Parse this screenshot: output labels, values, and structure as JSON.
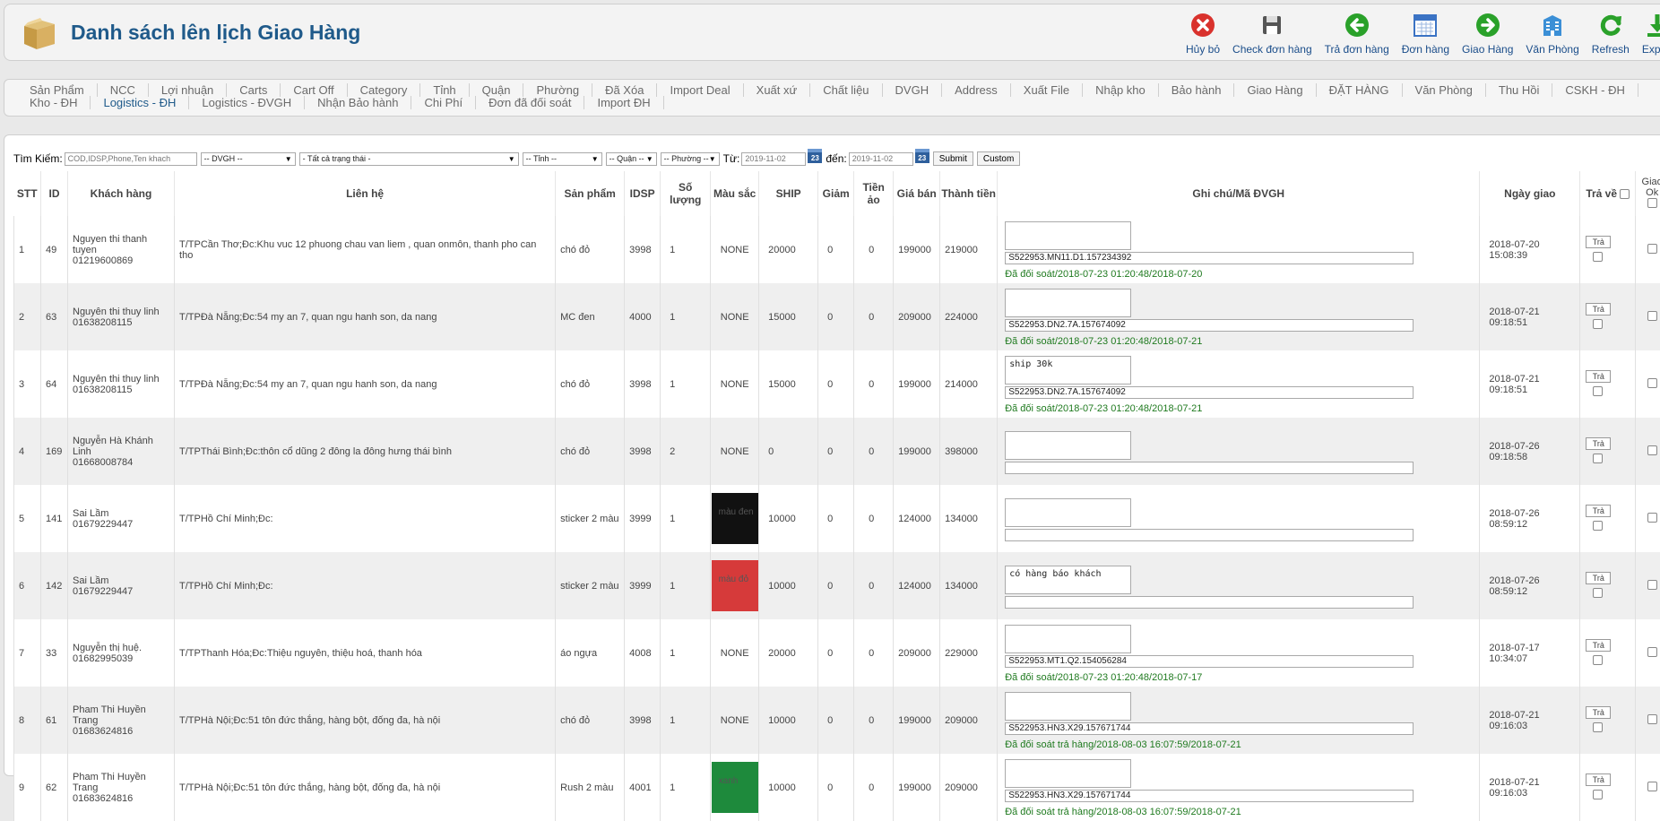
{
  "header": {
    "title": "Danh sách lên lịch Giao Hàng"
  },
  "toolbar": [
    {
      "label": "Hủy bỏ",
      "icon": "cancel-icon",
      "color": "#d9322d"
    },
    {
      "label": "Check đơn hàng",
      "icon": "save-icon",
      "color": "#555555"
    },
    {
      "label": "Trả đơn hàng",
      "icon": "back-arrow-icon",
      "color": "#2aa12a"
    },
    {
      "label": "Đơn hàng",
      "icon": "calendar-icon",
      "color": "#3b73c4"
    },
    {
      "label": "Giao Hàng",
      "icon": "forward-arrow-icon",
      "color": "#2aa12a"
    },
    {
      "label": "Văn Phòng",
      "icon": "building-icon",
      "color": "#3b8fd6"
    },
    {
      "label": "Refresh",
      "icon": "refresh-icon",
      "color": "#2aa12a"
    },
    {
      "label": "Export",
      "icon": "download-icon",
      "color": "#2aa12a"
    }
  ],
  "nav": {
    "row1": [
      "Sản Phẩm",
      "NCC",
      "Lợi nhuận",
      "Carts",
      "Cart Off",
      "Category",
      "Tỉnh",
      "Quận",
      "Phường",
      "Đã Xóa",
      "Import Deal",
      "Xuất xứ",
      "Chất liệu",
      "DVGH",
      "Address",
      "Xuất File",
      "Nhập kho",
      "Bảo hành",
      "Giao Hàng",
      "ĐẶT HÀNG",
      "Văn Phòng",
      "Thu Hồi",
      "CSKH - ĐH"
    ],
    "row2": [
      "Kho - ĐH",
      "Logistics - ĐH",
      "Logistics - ĐVGH",
      "Nhận Bảo hành",
      "Chi Phí",
      "Đơn đã đối soát",
      "Import ĐH"
    ]
  },
  "search": {
    "label": "Tìm Kiếm:",
    "placeholder": "COD,IDSP,Phone,Ten khach",
    "dvgh": "-- DVGH --",
    "status": "- Tất cả trạng thái -",
    "tinh": "-- Tỉnh --",
    "quan": "-- Quận --",
    "phuong": "-- Phường --",
    "from_label": "Từ:",
    "from": "2019-11-02",
    "to_label": "đến:",
    "to": "2019-11-02",
    "cal_label": "23",
    "submit": "Submit",
    "custom": "Custom"
  },
  "table": {
    "headers": {
      "stt": "STT",
      "id": "ID",
      "customer": "Khách hàng",
      "contact": "Liên hệ",
      "product": "Sản phẩm",
      "idsp": "IDSP",
      "qty": "Số lượng",
      "color": "Màu sắc",
      "ship": "SHIP",
      "discount": "Giảm",
      "virtual": "Tiền ảo",
      "price": "Giá bán",
      "total": "Thành tiền",
      "note": "Ghi chú/Mã ĐVGH",
      "date": "Ngày giao",
      "return": "Trả về",
      "ok": "Giao Ok"
    },
    "return_btn": "Trả",
    "rows": [
      {
        "stt": "1",
        "id": "49",
        "name": "Nguyen thi thanh tuyen",
        "phone": "01219600869",
        "contact": "T/TPCần Thơ;Đc:Khu vuc 12 phuong chau van liem , quan onmôn, thanh pho can tho",
        "product": "chó đỏ",
        "idsp": "3998",
        "qty": "1",
        "color": "NONE",
        "swatch": "",
        "ship": "20000",
        "discount": "0",
        "virtual": "0",
        "price": "199000",
        "total": "219000",
        "note": "",
        "code": "S522953.MN11.D1.157234392",
        "status": "Đã đối soát/2018-07-23 01:20:48/2018-07-20",
        "date": "2018-07-20",
        "time": "15:08:39"
      },
      {
        "stt": "2",
        "id": "63",
        "name": "Nguyên thi thuy linh",
        "phone": "01638208115",
        "contact": "T/TPĐà Nẵng;Đc:54 my an 7, quan ngu hanh son, da nang",
        "product": "MC đen",
        "idsp": "4000",
        "qty": "1",
        "color": "NONE",
        "swatch": "",
        "ship": "15000",
        "discount": "0",
        "virtual": "0",
        "price": "209000",
        "total": "224000",
        "note": "",
        "code": "S522953.DN2.7A.157674092",
        "status": "Đã đối soát/2018-07-23 01:20:48/2018-07-21",
        "date": "2018-07-21",
        "time": "09:18:51"
      },
      {
        "stt": "3",
        "id": "64",
        "name": "Nguyên thi thuy linh",
        "phone": "01638208115",
        "contact": "T/TPĐà Nẵng;Đc:54 my an 7, quan ngu hanh son, da nang",
        "product": "chó đỏ",
        "idsp": "3998",
        "qty": "1",
        "color": "NONE",
        "swatch": "",
        "ship": "15000",
        "discount": "0",
        "virtual": "0",
        "price": "199000",
        "total": "214000",
        "note": "ship 30k",
        "code": "S522953.DN2.7A.157674092",
        "status": "Đã đối soát/2018-07-23 01:20:48/2018-07-21",
        "date": "2018-07-21",
        "time": "09:18:51"
      },
      {
        "stt": "4",
        "id": "169",
        "name": "Nguyễn Hà Khánh Linh",
        "phone": "01668008784",
        "contact": "T/TPThái Bình;Đc:thôn cổ dũng 2 đông la đông hưng thái bình",
        "product": "chó đỏ",
        "idsp": "3998",
        "qty": "2",
        "color": "NONE",
        "swatch": "",
        "ship": "0",
        "discount": "0",
        "virtual": "0",
        "price": "199000",
        "total": "398000",
        "note": "",
        "code": "",
        "status": "",
        "date": "2018-07-26",
        "time": "09:18:58"
      },
      {
        "stt": "5",
        "id": "141",
        "name": "Sai Lầm",
        "phone": "01679229447",
        "contact": "T/TPHồ Chí Minh;Đc:",
        "product": "sticker 2 màu",
        "idsp": "3999",
        "qty": "1",
        "color": "màu đen",
        "swatch": "#111111",
        "ship": "10000",
        "discount": "0",
        "virtual": "0",
        "price": "124000",
        "total": "134000",
        "note": "",
        "code": "",
        "status": "",
        "date": "2018-07-26",
        "time": "08:59:12"
      },
      {
        "stt": "6",
        "id": "142",
        "name": "Sai Lầm",
        "phone": "01679229447",
        "contact": "T/TPHồ Chí Minh;Đc:",
        "product": "sticker 2 màu",
        "idsp": "3999",
        "qty": "1",
        "color": "màu đỏ",
        "swatch": "#d63a3a",
        "ship": "10000",
        "discount": "0",
        "virtual": "0",
        "price": "124000",
        "total": "134000",
        "note": "có hàng báo khách",
        "code": "",
        "status": "",
        "date": "2018-07-26",
        "time": "08:59:12"
      },
      {
        "stt": "7",
        "id": "33",
        "name": "Nguyễn thị huệ.",
        "phone": "01682995039",
        "contact": "T/TPThanh Hóa;Đc:Thiệu nguyên, thiệu hoá, thanh hóa",
        "product": "áo ngựa",
        "idsp": "4008",
        "qty": "1",
        "color": "NONE",
        "swatch": "",
        "ship": "20000",
        "discount": "0",
        "virtual": "0",
        "price": "209000",
        "total": "229000",
        "note": "",
        "code": "S522953.MT1.Q2.154056284",
        "status": "Đã đối soát/2018-07-23 01:20:48/2018-07-17",
        "date": "2018-07-17",
        "time": "10:34:07"
      },
      {
        "stt": "8",
        "id": "61",
        "name": "Pham Thi Huyền Trang",
        "phone": "01683624816",
        "contact": "T/TPHà Nội;Đc:51 tôn đức thắng, hàng bột, đống đa, hà nội",
        "product": "chó đỏ",
        "idsp": "3998",
        "qty": "1",
        "color": "NONE",
        "swatch": "",
        "ship": "10000",
        "discount": "0",
        "virtual": "0",
        "price": "199000",
        "total": "209000",
        "note": "",
        "code": "S522953.HN3.X29.157671744",
        "status": "Đã đối soát trả hàng/2018-08-03 16:07:59/2018-07-21",
        "date": "2018-07-21",
        "time": "09:16:03"
      },
      {
        "stt": "9",
        "id": "62",
        "name": "Pham Thi Huyền Trang",
        "phone": "01683624816",
        "contact": "T/TPHà Nội;Đc:51 tôn đức thắng, hàng bột, đống đa, hà nội",
        "product": "Rush 2 màu",
        "idsp": "4001",
        "qty": "1",
        "color": "xanh",
        "swatch": "#1e8a3c",
        "ship": "10000",
        "discount": "0",
        "virtual": "0",
        "price": "199000",
        "total": "209000",
        "note": "",
        "code": "S522953.HN3.X29.157671744",
        "status": "Đã đối soát trả hàng/2018-08-03 16:07:59/2018-07-21",
        "date": "2018-07-21",
        "time": "09:16:03"
      }
    ]
  }
}
